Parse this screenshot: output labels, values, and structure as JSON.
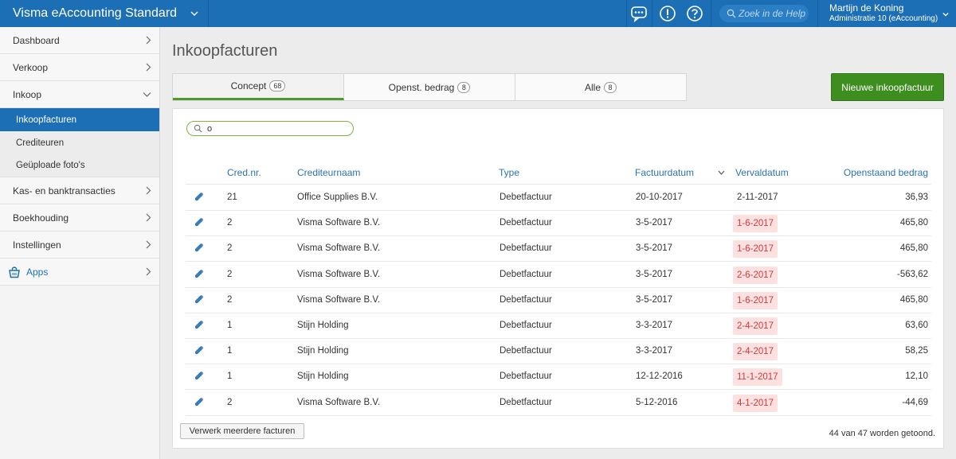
{
  "header": {
    "app_title": "Visma eAccounting Standard",
    "search_placeholder": "Zoek in de Help",
    "user_name": "Martijn de Koning",
    "administration": "Administratie 10 (eAccounting)"
  },
  "sidebar": {
    "items": [
      {
        "label": "Dashboard"
      },
      {
        "label": "Verkoop"
      },
      {
        "label": "Inkoop"
      }
    ],
    "sub_items": [
      {
        "label": "Inkoopfacturen"
      },
      {
        "label": "Crediteuren"
      },
      {
        "label": "Geüploade foto's"
      }
    ],
    "items_after": [
      {
        "label": "Kas- en banktransacties"
      },
      {
        "label": "Boekhouding"
      },
      {
        "label": "Instellingen"
      },
      {
        "label": "Apps"
      }
    ]
  },
  "main": {
    "title": "Inkoopfacturen",
    "tabs": [
      {
        "label": "Concept",
        "count": "68"
      },
      {
        "label": "Openst. bedrag",
        "count": "8"
      },
      {
        "label": "Alle",
        "count": "8"
      }
    ],
    "new_button": "Nieuwe inkoopfactuur",
    "filter_value": "o",
    "columns": {
      "cred_nr": "Cred.nr.",
      "name": "Crediteurnaam",
      "type": "Type",
      "invoice_date": "Factuurdatum",
      "due_date": "Vervaldatum",
      "amount": "Openstaand bedrag"
    },
    "rows": [
      {
        "nr": "21",
        "name": "Office Supplies B.V.",
        "type": "Debetfactuur",
        "date": "20-10-2017",
        "due": "2-11-2017",
        "late": false,
        "amount": "36,93"
      },
      {
        "nr": "2",
        "name": "Visma Software B.V.",
        "type": "Debetfactuur",
        "date": "3-5-2017",
        "due": "1-6-2017",
        "late": true,
        "amount": "465,80"
      },
      {
        "nr": "2",
        "name": "Visma Software B.V.",
        "type": "Debetfactuur",
        "date": "3-5-2017",
        "due": "1-6-2017",
        "late": true,
        "amount": "465,80"
      },
      {
        "nr": "2",
        "name": "Visma Software B.V.",
        "type": "Debetfactuur",
        "date": "3-5-2017",
        "due": "2-6-2017",
        "late": true,
        "amount": "-563,62"
      },
      {
        "nr": "2",
        "name": "Visma Software B.V.",
        "type": "Debetfactuur",
        "date": "3-5-2017",
        "due": "1-6-2017",
        "late": true,
        "amount": "465,80"
      },
      {
        "nr": "1",
        "name": "Stijn Holding",
        "type": "Debetfactuur",
        "date": "3-3-2017",
        "due": "2-4-2017",
        "late": true,
        "amount": "63,60"
      },
      {
        "nr": "1",
        "name": "Stijn Holding",
        "type": "Debetfactuur",
        "date": "3-3-2017",
        "due": "2-4-2017",
        "late": true,
        "amount": "58,25"
      },
      {
        "nr": "1",
        "name": "Stijn Holding",
        "type": "Debetfactuur",
        "date": "12-12-2016",
        "due": "11-1-2017",
        "late": true,
        "amount": "12,10"
      },
      {
        "nr": "2",
        "name": "Visma Software B.V.",
        "type": "Debetfactuur",
        "date": "5-12-2016",
        "due": "4-1-2017",
        "late": true,
        "amount": "-44,69"
      }
    ],
    "process_button": "Verwerk meerdere facturen",
    "result_count": "44 van 47 worden getoond."
  },
  "colors": {
    "brand_blue": "#1d6fb5",
    "accent_green": "#3d8d1f",
    "late_bg": "#fde0e0",
    "late_text": "#d23a3a",
    "link_blue": "#2b72b5"
  }
}
